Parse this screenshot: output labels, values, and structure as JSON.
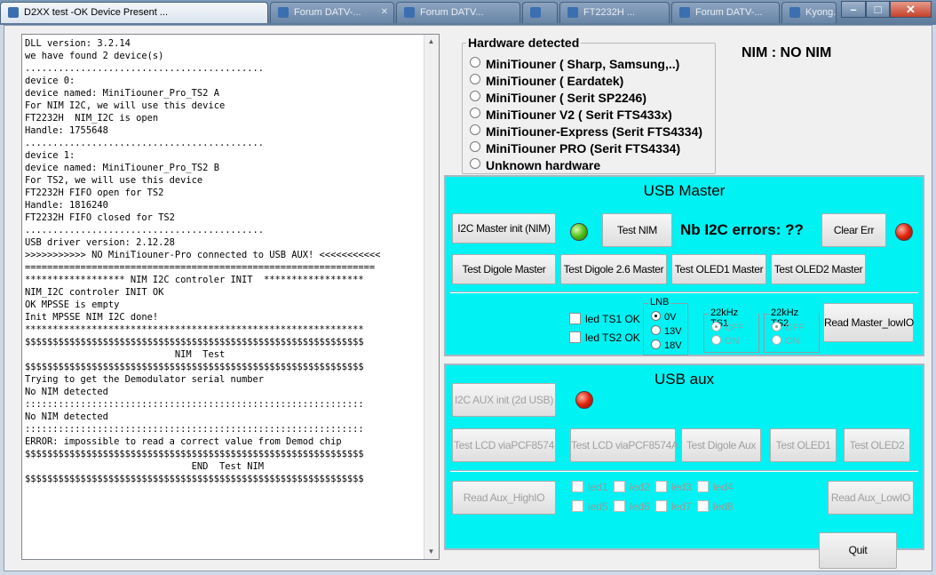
{
  "window": {
    "tabs": [
      {
        "label": "D2XX test -OK Device Present ...",
        "active": true
      },
      {
        "label": "Forum DATV-...",
        "active": false
      },
      {
        "label": "Forum DATV...",
        "active": false
      },
      {
        "label": "",
        "active": false
      },
      {
        "label": "FT2232H ...",
        "active": false
      },
      {
        "label": "Forum DATV-...",
        "active": false
      },
      {
        "label": "Kyong...",
        "active": false
      }
    ],
    "controls": {
      "minimize": "–",
      "maximize": "□",
      "close": "✕"
    }
  },
  "log": {
    "lines": [
      "DLL version: 3.2.14",
      "we have found 2 device(s)",
      "...........................................",
      "device 0:",
      "device named: MiniTiouner_Pro_TS2 A",
      "For NIM I2C, we will use this device",
      "FT2232H  NIM_I2C is open",
      "Handle: 1755648",
      "...........................................",
      "device 1:",
      "device named: MiniTiouner_Pro_TS2 B",
      "For TS2, we will use this device",
      "FT2232H FIFO open for TS2",
      "Handle: 1816240",
      "FT2232H FIFO closed for TS2",
      "...........................................",
      "USB driver version: 2.12.28",
      ">>>>>>>>>>> NO MiniTiouner-Pro connected to USB AUX! <<<<<<<<<<<",
      "===============================================================",
      "****************** NIM I2C controler INIT  ******************",
      "NIM_I2C controler INIT OK",
      "OK MPSSE is empty",
      "Init MPSSE NIM I2C done!",
      "*************************************************************",
      "$$$$$$$$$$$$$$$$$$$$$$$$$$$$$$$$$$$$$$$$$$$$$$$$$$$$$$$$$$$$$",
      "                           NIM  Test",
      "$$$$$$$$$$$$$$$$$$$$$$$$$$$$$$$$$$$$$$$$$$$$$$$$$$$$$$$$$$$$$",
      "Trying to get the Demodulator serial number",
      "No NIM detected",
      ":::::::::::::::::::::::::::::::::::::::::::::::::::::::::::::",
      "No NIM detected",
      ":::::::::::::::::::::::::::::::::::::::::::::::::::::::::::::",
      "ERROR: impossible to read a correct value from Demod chip",
      "$$$$$$$$$$$$$$$$$$$$$$$$$$$$$$$$$$$$$$$$$$$$$$$$$$$$$$$$$$$$$",
      "                              END  Test NIM",
      "$$$$$$$$$$$$$$$$$$$$$$$$$$$$$$$$$$$$$$$$$$$$$$$$$$$$$$$$$$$$$"
    ]
  },
  "hardware": {
    "legend": "Hardware detected",
    "options": [
      {
        "label": "MiniTiouner ( Sharp, Samsung,..)",
        "selected": false
      },
      {
        "label": "MiniTiouner ( Eardatek)",
        "selected": false
      },
      {
        "label": "MiniTiouner ( Serit SP2246)",
        "selected": false
      },
      {
        "label": "MiniTiouner V2 ( Serit FTS433x)",
        "selected": false
      },
      {
        "label": "MiniTiouner-Express (Serit FTS4334)",
        "selected": false
      },
      {
        "label": "MiniTiouner PRO  (Serit FTS4334)",
        "selected": false
      },
      {
        "label": "Unknown hardware",
        "selected": false
      }
    ]
  },
  "nim_status": "NIM : NO NIM",
  "usb_master": {
    "title": "USB Master",
    "i2c_init": "I2C Master init (NIM)",
    "test_nim": "Test NIM",
    "errors": "Nb I2C errors: ??",
    "clear_err": "Clear Err",
    "led_init_color": "#4fbf1a",
    "led_error_color": "#e0240c",
    "test_digole": "Test Digole Master",
    "test_digole26": "Test Digole 2.6 Master",
    "test_oled1": "Test OLED1 Master",
    "test_oled2": "Test OLED2 Master",
    "led_ts1": "led TS1 OK",
    "led_ts2": "led TS2 OK",
    "lnb": {
      "title": "LNB",
      "options": [
        {
          "label": "0V",
          "selected": true
        },
        {
          "label": "13V",
          "selected": false
        },
        {
          "label": "18V",
          "selected": false
        }
      ]
    },
    "ts1": {
      "title": "22kHz TS1",
      "off": "OFF",
      "on": "ON"
    },
    "ts2": {
      "title": "22kHz TS2",
      "off": "OFF",
      "on": "ON"
    },
    "read_lowio": "Read Master_lowIO"
  },
  "usb_aux": {
    "title": "USB aux",
    "i2c_init": "I2C AUX init (2d USB)",
    "led_color": "#e0240c",
    "test_lcd": "Test LCD viaPCF8574",
    "test_lcd_a": "Test LCD viaPCF8574A",
    "test_digole": "Test Digole Aux",
    "test_oled1": "Test OLED1",
    "test_oled2": "Test OLED2",
    "read_high": "Read Aux_HighIO",
    "read_low": "Read Aux_LowIO",
    "leds": [
      "led1",
      "led2",
      "led3",
      "led4",
      "led5",
      "led6",
      "led7",
      "led8"
    ]
  },
  "quit": "Quit"
}
